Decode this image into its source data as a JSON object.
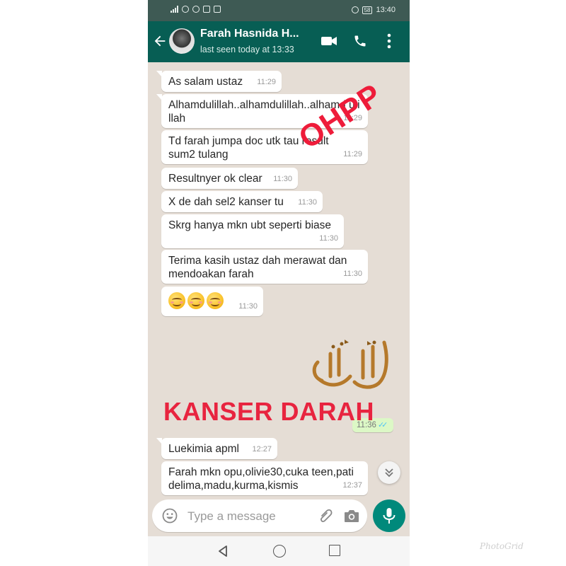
{
  "status_bar": {
    "battery": "58",
    "time": "13:40"
  },
  "header": {
    "contact_name": "Farah Hasnida H...",
    "last_seen": "last seen today at 13:33"
  },
  "messages": [
    {
      "text": "As salam ustaz",
      "time": "11:29"
    },
    {
      "text": "Alhamdulillah..alhamdulillah..alhamd ulillah",
      "time": "11:29"
    },
    {
      "text": "Td farah jumpa doc utk tau result sum2 tulang",
      "time": "11:29"
    },
    {
      "text": "Resultnyer ok clear",
      "time": "11:30"
    },
    {
      "text": "X de dah sel2 kanser tu",
      "time": "11:30"
    },
    {
      "text": "Skrg hanya mkn ubt seperti biase",
      "time": "11:30"
    },
    {
      "text": "Terima kasih ustaz dah merawat dan mendoakan farah",
      "time": "11:30"
    },
    {
      "emoji_count": 3,
      "emoji": "smiling-face",
      "time": "11:30"
    },
    {
      "text": "Luekimia apml",
      "time": "12:27"
    },
    {
      "text": "Farah mkn opu,olivie30,cuka teen,pati delima,madu,kurma,kismis",
      "time": "12:37"
    }
  ],
  "outgoing": {
    "time": "11:36",
    "status": "read"
  },
  "overlays": {
    "stamp": "OHPP",
    "caption": "KANSER DARAH"
  },
  "input": {
    "placeholder": "Type a message"
  },
  "watermark": "PhotoGrid",
  "colors": {
    "header": "#075e54",
    "status_bar": "#3e5a54",
    "chat_bg": "#e5ddd5",
    "outgoing_bubble": "#dcf8c6",
    "mic_button": "#00897b",
    "overlay_red": "#e8243f",
    "read_ticks": "#4fc3f7"
  }
}
